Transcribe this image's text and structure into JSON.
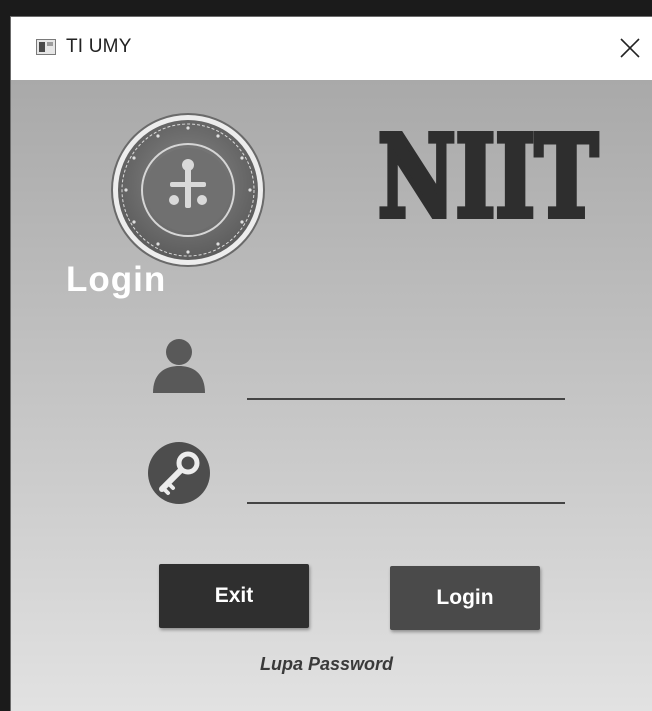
{
  "window": {
    "title": "TI UMY",
    "icon": "app-window-icon",
    "close_icon": "close-icon"
  },
  "branding": {
    "seal_icon": "university-seal-icon",
    "logo_text": "NIIT"
  },
  "form": {
    "heading": "Login",
    "username": {
      "icon": "user-icon",
      "value": "",
      "placeholder": ""
    },
    "password": {
      "icon": "key-icon",
      "value": "",
      "placeholder": ""
    },
    "exit_label": "Exit",
    "login_label": "Login",
    "forgot_label": "Lupa Password"
  },
  "colors": {
    "exit_button": "#2f2f2f",
    "login_button": "#4a4a4a",
    "heading_text": "#ffffff"
  }
}
